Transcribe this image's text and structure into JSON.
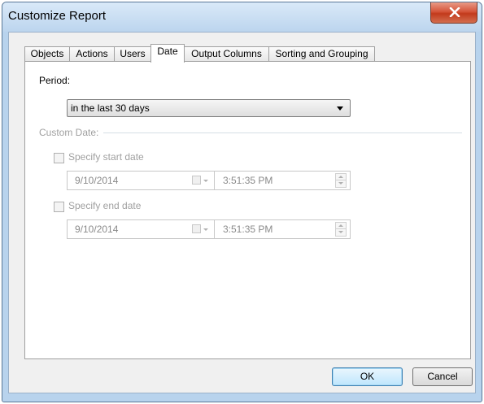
{
  "window": {
    "title": "Customize Report"
  },
  "tabs": [
    {
      "label": "Objects",
      "active": false
    },
    {
      "label": "Actions",
      "active": false
    },
    {
      "label": "Users",
      "active": false
    },
    {
      "label": "Date",
      "active": true
    },
    {
      "label": "Output Columns",
      "active": false
    },
    {
      "label": "Sorting and Grouping",
      "active": false
    }
  ],
  "period": {
    "label": "Period:",
    "selected": "in the last 30 days"
  },
  "custom_date": {
    "group_label": "Custom Date:",
    "start": {
      "checkbox_label": "Specify start date",
      "checked": false,
      "date": "9/10/2014",
      "time": "3:51:35 PM"
    },
    "end": {
      "checkbox_label": "Specify end date",
      "checked": false,
      "date": "9/10/2014",
      "time": "3:51:35 PM"
    }
  },
  "buttons": {
    "ok": "OK",
    "cancel": "Cancel"
  },
  "colors": {
    "window_frame": "#b8d3ed",
    "close_button": "#c8452a",
    "disabled_text": "#a0a0a0"
  }
}
